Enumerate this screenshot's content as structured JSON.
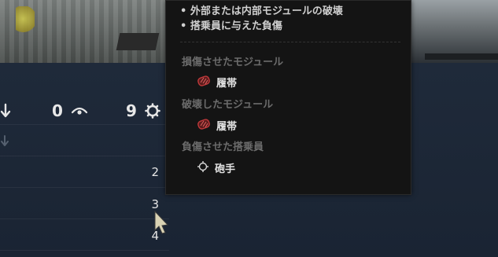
{
  "tooltip": {
    "bullets": [
      "• 外部または内部モジュールの破壊",
      "• 搭乗員に与えた負傷"
    ],
    "sections": [
      {
        "title": "損傷させたモジュール",
        "entry": "履帯",
        "icon": "track-icon"
      },
      {
        "title": "破壊したモジュール",
        "entry": "履帯",
        "icon": "track-icon"
      },
      {
        "title": "負傷させた搭乗員",
        "entry": "砲手",
        "icon": "gunner-crosshair-icon"
      }
    ]
  },
  "stats": {
    "arrow_icon": "arrow-down-icon",
    "spotted_value": "0",
    "spotted_icon": "eye-icon",
    "gear_value": "9",
    "gear_icon": "gear-icon"
  },
  "rows": [
    "2",
    "3",
    "4"
  ],
  "colors": {
    "panel_bg": "#1a2433",
    "tooltip_bg": "#141414",
    "section_title": "#6b6b6b",
    "track_icon": "#c0393b"
  }
}
